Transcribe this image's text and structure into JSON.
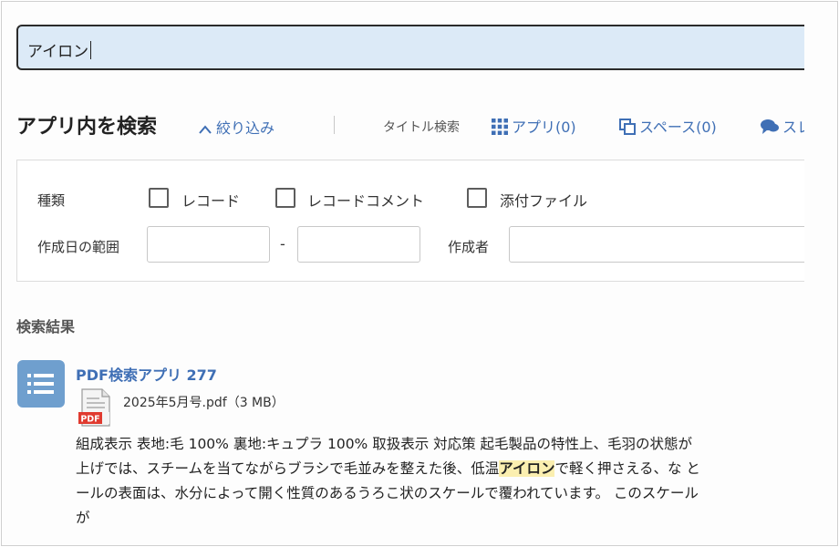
{
  "search": {
    "value": "アイロン"
  },
  "header": {
    "title": "アプリ内を検索",
    "filter_toggle": "絞り込み",
    "title_search": "タイトル検索",
    "nav": {
      "app": "アプリ(0)",
      "space": "スペース(0)",
      "thread": "スレッド"
    }
  },
  "filters": {
    "type_label": "種類",
    "checkboxes": [
      "レコード",
      "レコードコメント",
      "添付ファイル"
    ],
    "date_range_label": "作成日の範囲",
    "date_sep": "-",
    "creator_label": "作成者"
  },
  "results": {
    "heading": "検索結果",
    "items": [
      {
        "title": "PDF検索アプリ 277",
        "file": "2025年5月号.pdf（3 MB）",
        "snippet": {
          "line1": "組成表示 表地:毛 100% 裏地:キュプラ 100% 取扱表示 対応策 起毛製品の特性上、毛羽の状態が",
          "line2_before": "上げでは、スチームを当てながらブラシで毛並みを整えた後、低温",
          "line2_highlight": "アイロン",
          "line2_after": "で軽く押さえる、な と",
          "line3": "ールの表面は、水分によって開く性質のあるうろこ状のスケールで覆われています。 このスケール",
          "line4": "が"
        }
      }
    ]
  },
  "colors": {
    "accent": "#3f6fb5",
    "search_bg": "#dceaf7",
    "app_icon": "#6f9fce",
    "highlight": "#fbefb0",
    "pdf_red": "#e03a2f"
  }
}
